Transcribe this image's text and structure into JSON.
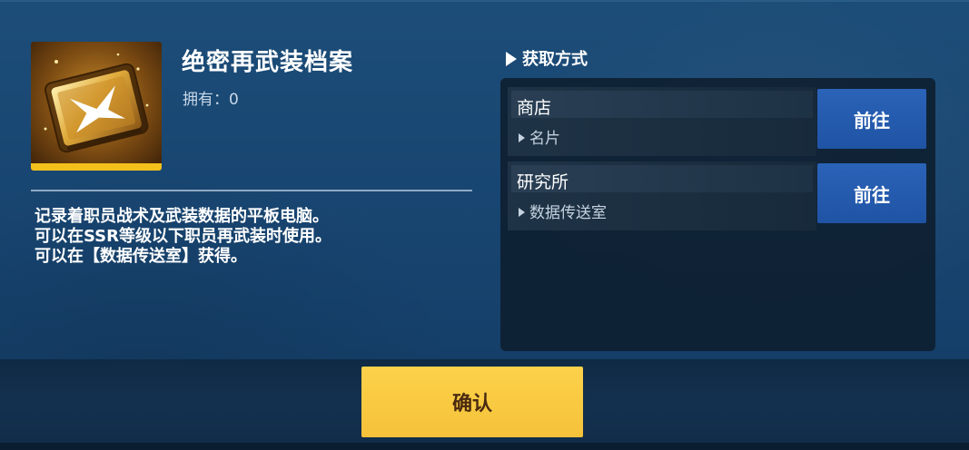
{
  "item": {
    "name": "绝密再武装档案",
    "owned_label": "拥有：",
    "owned_count": "0",
    "icon": "gold-tablet-icon",
    "rarity_color": "#f4c01c",
    "description": [
      "记录着职员战术及武装数据的平板电脑。",
      "可以在SSR等级以下职员再武装时使用。",
      "可以在【数据传送室】获得。"
    ]
  },
  "acquisition": {
    "title": "获取方式",
    "sources": [
      {
        "name": "商店",
        "sub": "名片",
        "button": "前往"
      },
      {
        "name": "研究所",
        "sub": "数据传送室",
        "button": "前往"
      }
    ]
  },
  "confirm_label": "确认",
  "colors": {
    "background": "#184571",
    "goto_button": "#2b63b8",
    "confirm_button": "#fcd24a",
    "confirm_text": "#4a2a10"
  }
}
